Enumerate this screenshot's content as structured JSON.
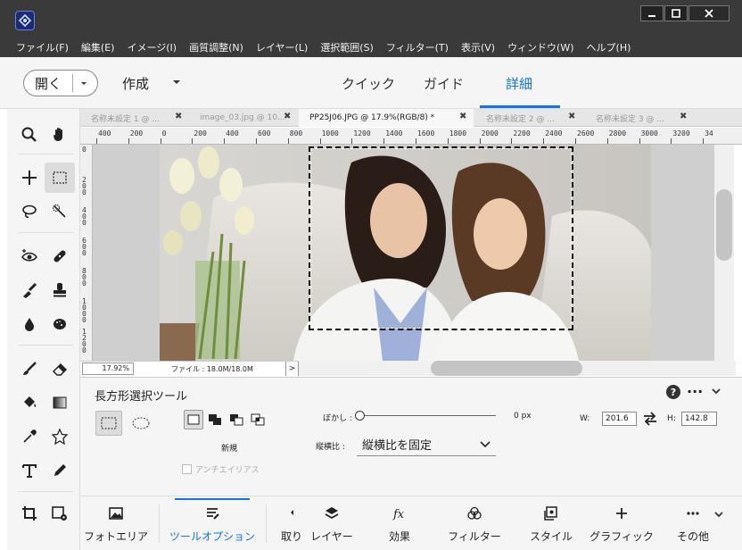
{
  "menu": [
    "ファイル(F)",
    "編集(E)",
    "イメージ(I)",
    "画質調整(N)",
    "レイヤー(L)",
    "選択範囲(S)",
    "フィルター(T)",
    "表示(V)",
    "ウィンドウ(W)",
    "ヘルプ(H)"
  ],
  "modebar": {
    "open_label": "開く",
    "create_label": "作成",
    "tabs": {
      "quick": "クイック",
      "guide": "ガイド",
      "expert": "詳細"
    },
    "active_tab": "expert"
  },
  "doc_tabs": [
    {
      "label": "名称未設定 1 @ ...",
      "active": false
    },
    {
      "label": "image_03.jpg @ 10...",
      "active": false
    },
    {
      "label": "PP25J06.JPG @ 17.9%(RGB/8) *",
      "active": true
    },
    {
      "label": "名称未設定 2 @ ...",
      "active": false
    },
    {
      "label": "名称未設定 3 @ ...",
      "active": false
    }
  ],
  "ruler_top": [
    "400",
    "200",
    "0",
    "200",
    "400",
    "600",
    "800",
    "1000",
    "1200",
    "1400",
    "1600",
    "1800",
    "2000",
    "2200",
    "2400",
    "2600",
    "2800",
    "3000",
    "3200",
    "34"
  ],
  "ruler_left": [
    "0",
    "200",
    "400",
    "600",
    "800",
    "1000",
    "1200"
  ],
  "status": {
    "zoom": "17.92%",
    "file_info": "ファイル : 18.0M/18.0M",
    "arrow": ">"
  },
  "tool_options": {
    "title": "長方形選択ツール",
    "new_label": "新規",
    "antialias_label": "アンチエイリアス",
    "feather_label": "ぼかし :",
    "feather_value": "0 px",
    "feather_level": 0,
    "ratio_label": "縦横比 :",
    "ratio_value": "縦横比を固定",
    "w_label": "W:",
    "w_value": "201.6",
    "h_label": "H:",
    "h_value": "142.8"
  },
  "panels": [
    {
      "label": "フォトエリア",
      "icon": "photo-bin-icon",
      "active": false
    },
    {
      "label": "ツールオプション",
      "icon": "tool-options-icon",
      "active": true
    },
    {
      "label": "取り",
      "icon": "undo-icon",
      "active": false
    },
    {
      "label": "レイヤー",
      "icon": "layers-icon",
      "active": false
    },
    {
      "label": "効果",
      "icon": "fx-icon",
      "active": false
    },
    {
      "label": "フィルター",
      "icon": "filters-icon",
      "active": false
    },
    {
      "label": "スタイル",
      "icon": "styles-icon",
      "active": false
    },
    {
      "label": "グラフィック",
      "icon": "graphics-icon",
      "active": false
    },
    {
      "label": "その他",
      "icon": "more-icon",
      "active": false
    }
  ],
  "colors": {
    "accent": "#1473e6",
    "titlebar": "#3a3a3a"
  }
}
